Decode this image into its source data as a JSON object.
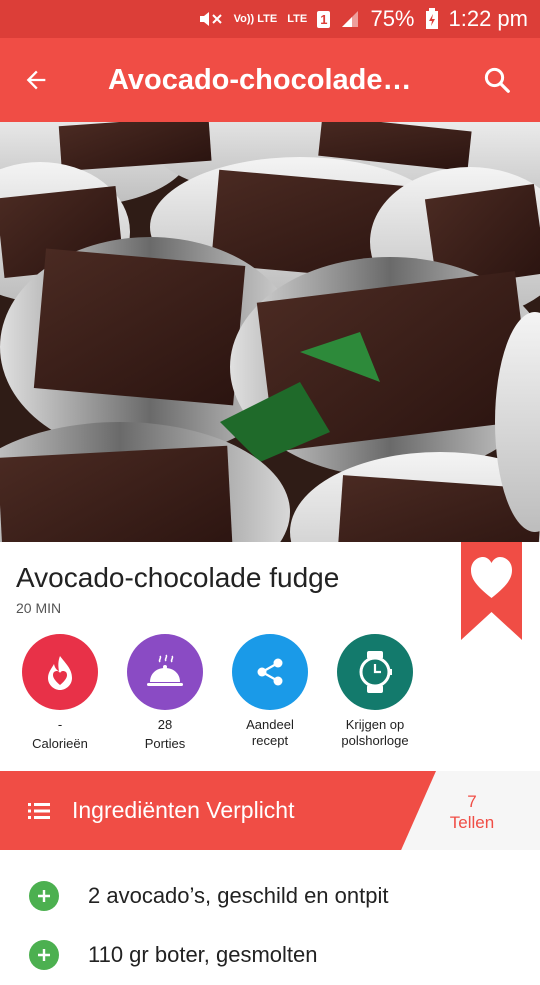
{
  "status_bar": {
    "volte": "Vo)) LTE",
    "lte": "LTE",
    "sim": "1",
    "battery": "75%",
    "time": "1:22 pm"
  },
  "app_bar": {
    "title": "Avocado-chocolade fu…",
    "back_icon": "arrow-left-icon",
    "search_icon": "search-icon"
  },
  "recipe": {
    "title": "Avocado-chocolade fudge",
    "time": "20 MIN"
  },
  "actions": [
    {
      "value": "-",
      "label": "Calorieën",
      "icon": "flame-heart-icon",
      "color": "#e83148"
    },
    {
      "value": "28",
      "label": "Porties",
      "icon": "cloche-icon",
      "color": "#8a4bc4"
    },
    {
      "value": "Aandeel",
      "label": "recept",
      "icon": "share-icon",
      "color": "#1a9ae8"
    },
    {
      "value": "Krijgen op",
      "label": "polshorloge",
      "icon": "watch-icon",
      "color": "#137a6c"
    }
  ],
  "ingredients_header": {
    "label": "Ingrediënten Verplicht",
    "count": "7",
    "count_label": "Tellen"
  },
  "ingredients": [
    "2 avocado’s, geschild en ontpit",
    "110 gr boter, gesmolten"
  ],
  "colors": {
    "status_bar": "#dc3e38",
    "app_bar": "#f04d45",
    "accent": "#f04d45",
    "add_button": "#4cb050"
  }
}
